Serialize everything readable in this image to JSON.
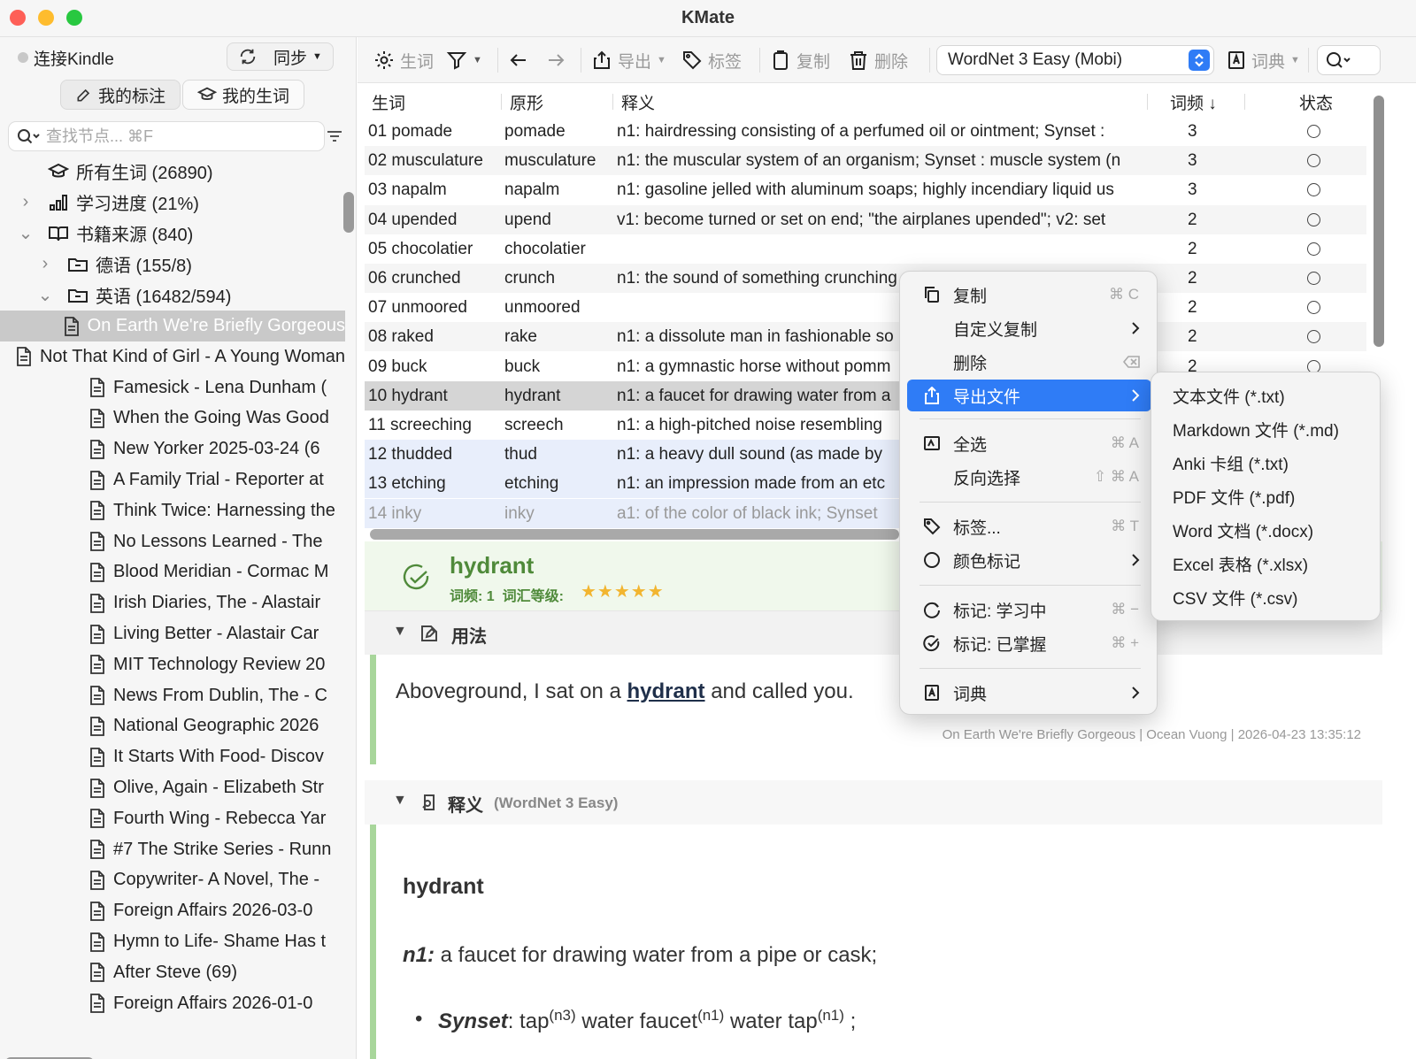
{
  "window": {
    "title": "KMate"
  },
  "sidebar": {
    "connect_label": "连接Kindle",
    "sync_label": "同步",
    "tab_annotations": "我的标注",
    "tab_words": "我的生词",
    "search_placeholder": "查找节点... ⌘F",
    "tree": [
      {
        "label": "所有生词 (26890)",
        "icon": "graduation-cap-icon"
      },
      {
        "label": "学习进度 (21%)",
        "icon": "bar-chart-icon"
      },
      {
        "label": "书籍来源 (840)",
        "icon": "book-icon"
      },
      {
        "label": "德语 (155/8)",
        "icon": "folder-icon"
      },
      {
        "label": "英语 (16482/594)",
        "icon": "folder-icon"
      }
    ],
    "books": [
      "On Earth We're Briefly Gorgeous",
      "Not That Kind of Girl - A Young Woman",
      "Famesick - Lena Dunham (",
      "When the Going Was Good",
      "New Yorker 2025-03-24 (6",
      "A Family Trial - Reporter at",
      "Think Twice: Harnessing the",
      "No Lessons Learned - The",
      "Blood Meridian - Cormac M",
      "Irish Diaries, The - Alastair",
      "Living Better - Alastair Car",
      "MIT Technology Review 20",
      "News From Dublin, The - C",
      "National Geographic 2026",
      "It Starts With Food- Discov",
      "Olive, Again - Elizabeth Str",
      "Fourth Wing - Rebecca Yar",
      "#7 The Strike Series - Runn",
      "Copywriter- A Novel, The -",
      "Foreign Affairs 2026-03-0",
      "Hymn to Life- Shame Has t",
      "After Steve (69)",
      "Foreign Affairs 2026-01-0"
    ]
  },
  "toolbar": {
    "words_label": "生词",
    "export_label": "导出",
    "tag_label": "标签",
    "copy_label": "复制",
    "delete_label": "删除",
    "dictionary_selected": "WordNet 3 Easy (Mobi)",
    "dict_label": "词典"
  },
  "table": {
    "headers": {
      "word": "生词",
      "lemma": "原形",
      "definition": "释义",
      "freq": "词频 ↓",
      "status": "状态"
    },
    "rows": [
      {
        "word": "01 pomade",
        "lemma": "pomade",
        "def": "n1: hairdressing consisting of a perfumed oil or ointment; Synset :",
        "freq": "3"
      },
      {
        "word": "02 musculature",
        "lemma": "musculature",
        "def": "n1: the muscular system of an organism; Synset : muscle system (n",
        "freq": "3"
      },
      {
        "word": "03 napalm",
        "lemma": "napalm",
        "def": "n1: gasoline jelled with aluminum soaps; highly incendiary liquid us",
        "freq": "3"
      },
      {
        "word": "04 upended",
        "lemma": "upend",
        "def": "v1: become turned or set on end; \"the airplanes upended\"; v2: set",
        "freq": "2"
      },
      {
        "word": "05 chocolatier",
        "lemma": "chocolatier",
        "def": "",
        "freq": "2"
      },
      {
        "word": "06 crunched",
        "lemma": "crunch",
        "def": "n1: the sound of something crunching",
        "freq": "2"
      },
      {
        "word": "07 unmoored",
        "lemma": "unmoored",
        "def": "",
        "freq": "2"
      },
      {
        "word": "08 raked",
        "lemma": "rake",
        "def": "n1: a dissolute man in fashionable so",
        "freq": "2"
      },
      {
        "word": "09 buck",
        "lemma": "buck",
        "def": "n1: a gymnastic horse without pomm",
        "freq": "2"
      },
      {
        "word": "10 hydrant",
        "lemma": "hydrant",
        "def": "n1: a faucet for drawing water from a",
        "freq": ""
      },
      {
        "word": "11 screeching",
        "lemma": "screech",
        "def": "n1: a high-pitched noise resembling",
        "freq": ""
      },
      {
        "word": "12 thudded",
        "lemma": "thud",
        "def": "n1: a heavy dull sound (as made by",
        "freq": ""
      },
      {
        "word": "13 etching",
        "lemma": "etching",
        "def": "n1: an impression made from an etc",
        "freq": ""
      },
      {
        "word": "14 inky",
        "lemma": "inky",
        "def": "a1: of the color of black ink; Synset",
        "freq": ""
      }
    ]
  },
  "detail": {
    "word": "hydrant",
    "meta": "词频: 1  词汇等级:",
    "stars": "★★★★★",
    "usage_title": "用法",
    "usage_before": "Aboveground, I sat on a ",
    "usage_word": "hydrant",
    "usage_after": " and called you.",
    "usage_source": "On Earth We're Briefly Gorgeous | Ocean Vuong | 2026-04-23 13:35:12",
    "def_title": "释义",
    "def_dict": "(WordNet 3 Easy)",
    "def_word": "hydrant",
    "def_n1_label": "n1:",
    "def_n1_text": " a faucet for drawing water from a pipe or cask;",
    "synset_label": "Synset",
    "synset_items": [
      {
        "word": "tap",
        "sup": "(n3)"
      },
      {
        "word": "water faucet",
        "sup": "(n1)"
      },
      {
        "word": "water tap",
        "sup": "(n1)"
      }
    ],
    "synset_end": ";"
  },
  "context_menu": {
    "items": [
      {
        "label": "复制",
        "shortcut": "⌘ C"
      },
      {
        "label": "自定义复制"
      },
      {
        "label": "删除"
      },
      {
        "label": "导出文件"
      },
      {
        "label": "全选",
        "shortcut": "⌘ A"
      },
      {
        "label": "反向选择",
        "shortcut": "⇧ ⌘ A"
      },
      {
        "label": "标签...",
        "shortcut": "⌘ T"
      },
      {
        "label": "颜色标记"
      },
      {
        "label": "标记: 学习中",
        "shortcut": "⌘ −"
      },
      {
        "label": "标记: 已掌握",
        "shortcut": "⌘ +"
      },
      {
        "label": "词典"
      }
    ]
  },
  "export_submenu": {
    "items": [
      "文本文件 (*.txt)",
      "Markdown 文件 (*.md)",
      "Anki 卡组 (*.txt)",
      "PDF 文件 (*.pdf)",
      "Word 文档 (*.docx)",
      "Excel 表格 (*.xlsx)",
      "CSV 文件 (*.csv)"
    ]
  },
  "colors": {
    "accent": "#2f7cf6",
    "selection": "#c9c9c9",
    "usage_bar": "#a8d69b",
    "star": "#f2b530",
    "word_green": "#4f8a3a"
  }
}
